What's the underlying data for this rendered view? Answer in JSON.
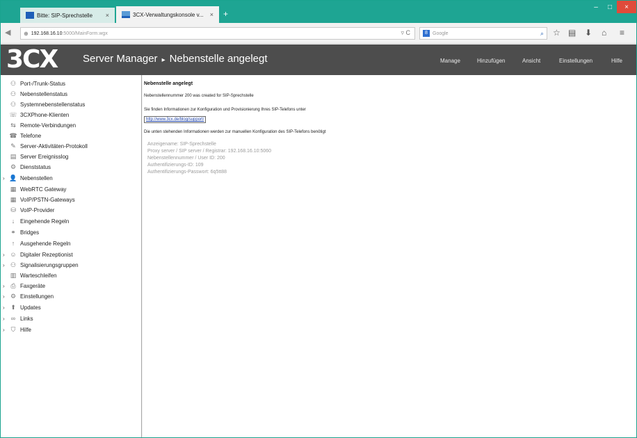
{
  "browser": {
    "tabs": [
      {
        "label": "Bitte: SIP-Sprechstelle",
        "close": "×"
      },
      {
        "label": "3CX-Verwaltungskonsole v...",
        "close": "×"
      }
    ],
    "new_tab": "+",
    "window_controls": {
      "minimize": "–",
      "maximize": "□",
      "close": "×"
    },
    "url_host": "192.168.16.10",
    "url_path": ":5000/MainForm.wgx",
    "search_engine": "8",
    "search_placeholder": "Google"
  },
  "app": {
    "logo": "3CX",
    "title_main": "Server Manager",
    "title_arrow": "▸",
    "title_page": "Nebenstelle angelegt",
    "menu": [
      "Manage",
      "Hinzufügen",
      "Ansicht",
      "Einstellungen",
      "Hilfe"
    ]
  },
  "sidebar": {
    "items": [
      {
        "label": "Port-/Trunk-Status",
        "expandable": false
      },
      {
        "label": "Nebenstellenstatus",
        "expandable": false
      },
      {
        "label": "Systemnebenstellenstatus",
        "expandable": false
      },
      {
        "label": "3CXPhone-Klienten",
        "expandable": false
      },
      {
        "label": "Remote-Verbindungen",
        "expandable": false
      },
      {
        "label": "Telefone",
        "expandable": false
      },
      {
        "label": "Server-Aktivitäten-Protokoll",
        "expandable": false
      },
      {
        "label": "Server Ereignisslog",
        "expandable": false
      },
      {
        "label": "Dienststatus",
        "expandable": false
      },
      {
        "label": "Nebenstellen",
        "expandable": true
      },
      {
        "label": "WebRTC Gateway",
        "expandable": false
      },
      {
        "label": "VoIP/PSTN-Gateways",
        "expandable": false
      },
      {
        "label": "VoIP-Provider",
        "expandable": false
      },
      {
        "label": "Eingehende Regeln",
        "expandable": false
      },
      {
        "label": "Bridges",
        "expandable": false
      },
      {
        "label": "Ausgehende Regeln",
        "expandable": false
      },
      {
        "label": "Digitaler Rezeptionist",
        "expandable": true
      },
      {
        "label": "Signalisierungsgruppen",
        "expandable": true
      },
      {
        "label": "Warteschleifen",
        "expandable": false
      },
      {
        "label": "Faxgeräte",
        "expandable": true
      },
      {
        "label": "Einstellungen",
        "expandable": true
      },
      {
        "label": "Updates",
        "expandable": true
      },
      {
        "label": "Links",
        "expandable": true
      },
      {
        "label": "Hilfe",
        "expandable": true
      }
    ],
    "expand_glyph": "›"
  },
  "content": {
    "title": "Nebenstelle angelegt",
    "line1": "Nebenstellennummer 200 was created for SIP-Sprechstelle",
    "line2": "Sie finden Informationen zur Konfiguration und Provisionierung Ihres SIP-Telefons unter",
    "link": "http://www.3cx.de/blog/support/",
    "line3": "Die unten stehenden Informationen werden zur manuellen Konfiguration des SIP-Telefons benötigt",
    "details": [
      "Anzeigename: SIP-Sprechstelle",
      "Proxy server / SIP server / Registrar: 192.168.16.10:5060",
      "Nebenstellennummer / User ID: 200",
      "Authentifizierungs-ID: 109",
      "Authentifizierungs-Passwort: 6q5tt88"
    ]
  }
}
